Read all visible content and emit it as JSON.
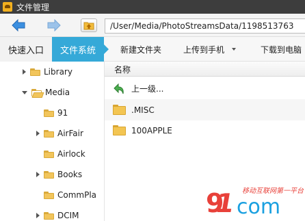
{
  "window": {
    "title": "文件管理"
  },
  "toolbar": {
    "back_icon": "arrow-left-icon",
    "forward_icon": "arrow-right-icon",
    "up_icon": "folder-up-icon",
    "path": "/User/Media/PhotoStreamsData/1198513763"
  },
  "tabs": [
    {
      "label": "快速入口",
      "active": false
    },
    {
      "label": "文件系统",
      "active": true
    }
  ],
  "actions": {
    "new_folder": "新建文件夹",
    "upload": "上传到手机",
    "download": "下载到电脑"
  },
  "tree": [
    {
      "label": "Library",
      "level": 1,
      "expander": "collapsed",
      "open": false
    },
    {
      "label": "Media",
      "level": 1,
      "expander": "expanded",
      "open": true
    },
    {
      "label": "91",
      "level": 2,
      "expander": "none",
      "open": false
    },
    {
      "label": "AirFair",
      "level": 2,
      "expander": "collapsed",
      "open": false
    },
    {
      "label": "Airlock",
      "level": 2,
      "expander": "none",
      "open": false
    },
    {
      "label": "Books",
      "level": 2,
      "expander": "collapsed",
      "open": false
    },
    {
      "label": "CommPla",
      "level": 2,
      "expander": "none",
      "open": false
    },
    {
      "label": "DCIM",
      "level": 2,
      "expander": "collapsed",
      "open": false
    }
  ],
  "list": {
    "column_name": "名称",
    "rows": [
      {
        "label": "上一级...",
        "icon": "back-arrow-icon"
      },
      {
        "label": ".MISC",
        "icon": "folder-icon"
      },
      {
        "label": "100APPLE",
        "icon": "folder-icon"
      }
    ]
  },
  "watermark": {
    "tagline": "移动互联网第一平台",
    "brand": "com"
  },
  "colors": {
    "accent": "#35a9d8",
    "folder": "#f2c55b",
    "arrow": "#3b8fe0",
    "watermark": "#1aa0e0",
    "watermark_nine": "#e8413a"
  }
}
